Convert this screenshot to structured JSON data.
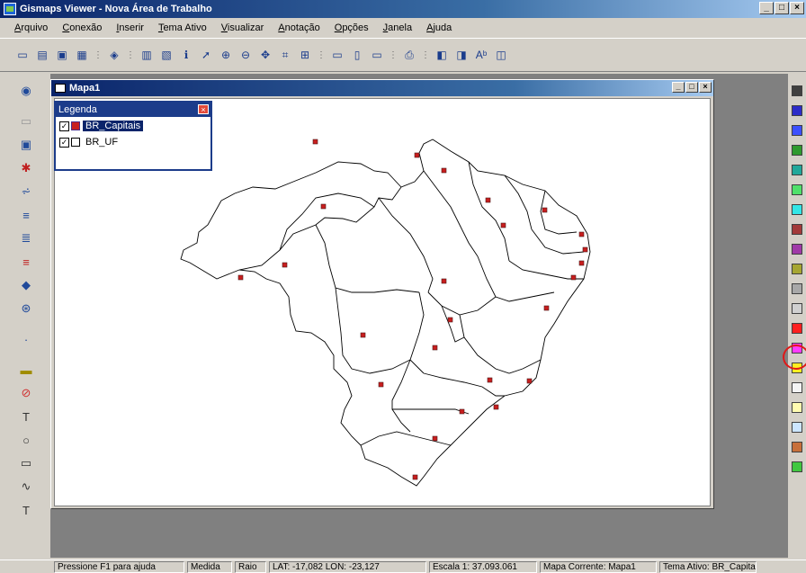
{
  "window": {
    "title": "Gismaps Viewer - Nova Área de Trabalho",
    "controls": [
      "_",
      "□",
      "×"
    ]
  },
  "menu": [
    "Arquivo",
    "Conexão",
    "Inserir",
    "Tema Ativo",
    "Visualizar",
    "Anotação",
    "Opções",
    "Janela",
    "Ajuda"
  ],
  "toolbar": {
    "icons": [
      "new-workspace-icon",
      "open-icon",
      "save-icon",
      "layout-icon",
      "theme-icon",
      "table-icon",
      "attribute-icon",
      "info-icon",
      "select-pointer-icon",
      "zoom-in-icon",
      "zoom-out-icon",
      "pan-icon",
      "fit-extent-icon",
      "full-extent-icon",
      "window-arrange-icon",
      "tile-icon",
      "measure-icon",
      "print-icon",
      "add-theme-icon",
      "edit-theme-icon",
      "text-font-icon",
      "legend-icon"
    ]
  },
  "child_window": {
    "title": "Mapa1",
    "controls": [
      "_",
      "□",
      "×"
    ]
  },
  "legend": {
    "title": "Legenda",
    "close": "×",
    "items": [
      {
        "label": "BR_Capitais",
        "checked": "✓",
        "symbol": "square-filled"
      },
      {
        "label": "BR_UF",
        "checked": "✓",
        "symbol": "square-empty"
      }
    ]
  },
  "palette": {
    "colors": [
      "#404040",
      "#2c2cc8",
      "#3c50ff",
      "#2e9a2e",
      "#21a89a",
      "#4fe06a",
      "#33e6e6",
      "#a33a3a",
      "#a03aa8",
      "#a6a632",
      "#a8a8a8",
      "#d0d0d0",
      "#ff2020",
      "#ff3cff",
      "#ffee22",
      "#f4f4f4",
      "#fffcb0",
      "#cce6ff",
      "#c8703a",
      "#40c840"
    ],
    "selected_color": "#ff2020"
  },
  "statusbar": {
    "help": "Pressione F1 para ajuda",
    "medida": "Medida",
    "raio": "Raio",
    "coords": "LAT: -17,082  LON: -23,127",
    "scale": "Escala 1: 37.093.061",
    "current_map": "Mapa Corrente: Mapa1",
    "active_theme": "Tema Ativo: BR_Capita"
  }
}
